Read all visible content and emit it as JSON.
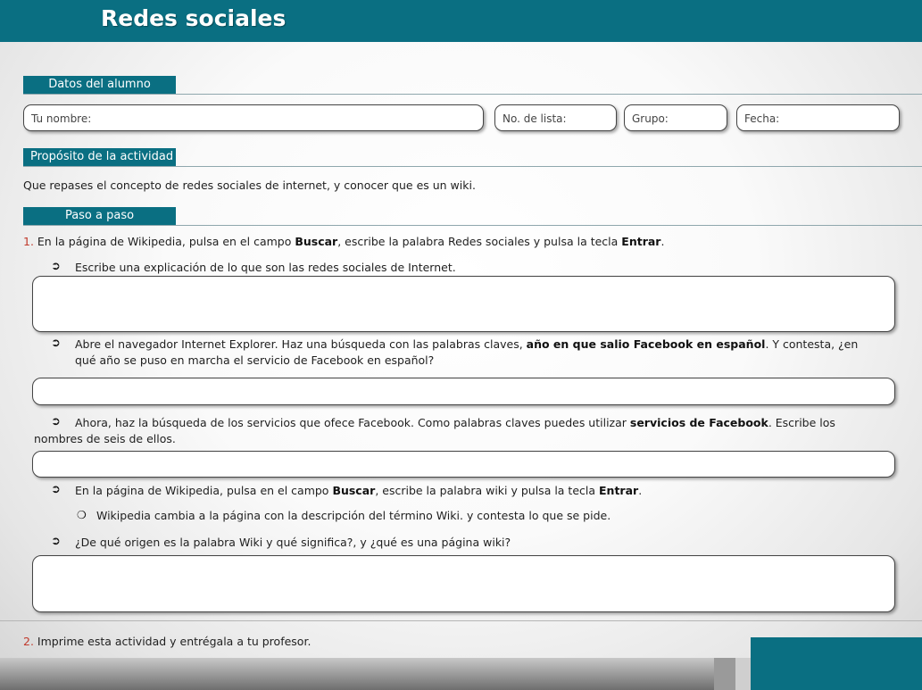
{
  "header": {
    "title": "Redes sociales"
  },
  "datos": {
    "tab": "Datos del alumno",
    "fields": {
      "nombre": "Tu nombre:",
      "lista": "No. de lista:",
      "grupo": "Grupo:",
      "fecha": "Fecha:"
    }
  },
  "proposito": {
    "tab": "Propósito de la actividad",
    "text": "Que repases el concepto de redes sociales de internet, y conocer que es un wiki."
  },
  "paso": {
    "tab": "Paso a paso",
    "step1": {
      "num": "1.",
      "a": " En la página de Wikipedia, pulsa en el campo ",
      "b": "Buscar",
      "c": ", escribe la palabra Redes sociales y pulsa la tecla ",
      "d": "Entrar",
      "e": "."
    },
    "q1": "Escribe  una explicación de lo que son las redes sociales de Internet.",
    "q2": {
      "a": "Abre el navegador Internet Explorer. Haz una búsqueda con las palabras claves, ",
      "b": "año en que salio Facebook en español",
      "c": ".  Y contesta, ¿en",
      "line2": "qué año se puso en marcha el servicio de Facebook en español?"
    },
    "q3": {
      "a": "Ahora, haz la búsqueda de los servicios que ofece Facebook. Como palabras claves puedes utilizar ",
      "b": "servicios de Facebook",
      "c": ". Escribe los",
      "line2": "nombres de seis de ellos."
    },
    "q4": {
      "a": "En la página de Wikipedia, pulsa en el campo ",
      "b": "Buscar",
      "c": ", escribe la palabra wiki  y pulsa la tecla ",
      "d": "Entrar",
      "e": "."
    },
    "q4sub": "Wikipedia cambia a la página con la descripción del término Wiki. y contesta lo que se pide.",
    "q5": "¿De qué origen es la palabra Wiki y qué significa?, y  ¿qué es una página wiki?",
    "step2": {
      "num": "2.",
      "text": " Imprime esta actividad y entrégala a tu profesor."
    },
    "bullet_glyph": "➲",
    "sub_bullet_glyph": "❍"
  },
  "colors": {
    "accent": "#0a6f82",
    "number": "#c0392b"
  }
}
